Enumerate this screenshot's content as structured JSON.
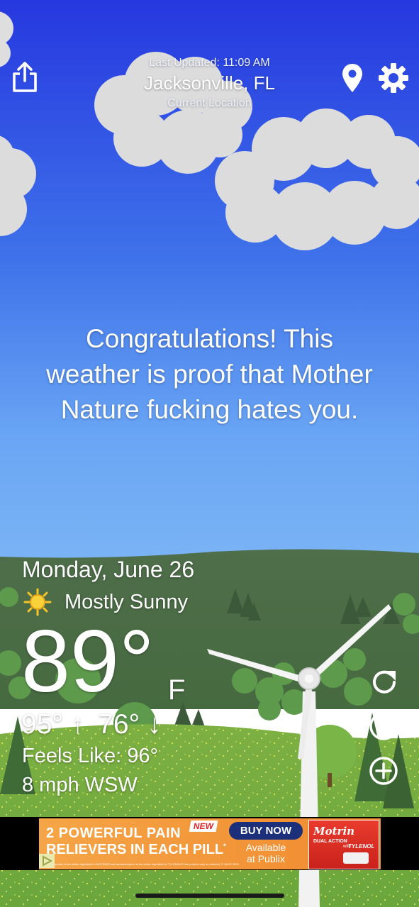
{
  "header": {
    "last_updated": "Last Updated: 11:09 AM",
    "city": "Jacksonville, FL",
    "location_label": "Current Location"
  },
  "message": {
    "line1": "Congratulations! This",
    "line2": "weather is proof that Mother",
    "line3": "Nature fucking hates you."
  },
  "weather": {
    "date": "Monday, June 26",
    "condition": "Mostly Sunny",
    "temperature": "89°",
    "unit": "F",
    "high": "95°",
    "low": "76°",
    "feels_like": "Feels Like: 96°",
    "wind": "8 mph WSW"
  },
  "ad": {
    "headline1": "2 POWERFUL PAIN",
    "headline2": "RELIEVERS IN EACH PILL",
    "headline_mark": "*",
    "new_badge": "NEW",
    "cta": "BUY NOW",
    "availability_line1": "Available",
    "availability_line2": "at Publix",
    "fineprint": "*Ibuprofen is the active ingredient in MOTRIN® and acetaminophen is the active ingredient in TYLENOL®   Use product only as directed. © J&JCI 2023",
    "product_brand": "Motrin",
    "product_sub": "DUAL ACTION",
    "product_with": "with",
    "product_partner": "TYLENOL"
  },
  "icons": {
    "share": "share-icon",
    "location": "location-pin-icon",
    "settings": "gear-icon",
    "refresh": "refresh-icon",
    "theme": "moon-icon",
    "add": "add-icon",
    "sun": "sun-icon",
    "ad_choices": "ad-choices-icon"
  },
  "colors": {
    "sky_top": "#2a3ee0",
    "sky_bottom": "#6aa6f4",
    "ad_orange": "#f39a3c",
    "ad_navy": "#1b2f7a"
  }
}
